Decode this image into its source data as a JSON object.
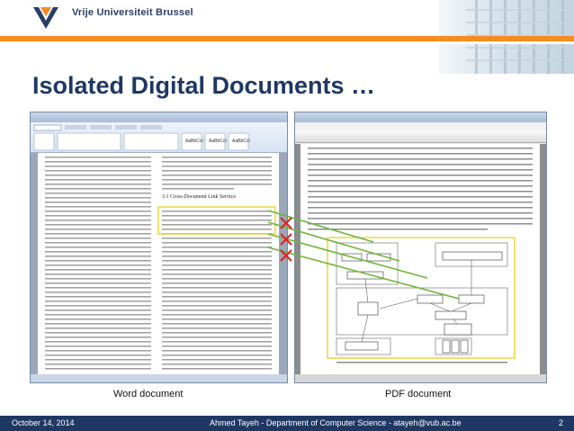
{
  "header": {
    "university_name": "Vrije Universiteit Brussel"
  },
  "slide": {
    "title": "Isolated Digital Documents …"
  },
  "screenshots": {
    "word_caption": "Word document",
    "pdf_caption": "PDF document",
    "word_section_heading": "3.1   Cross-Document Link Service"
  },
  "footer": {
    "date": "October 14, 2014",
    "author": "Ahmed Tayeh - Department of Computer Science - atayeh@vub.ac.be",
    "page_number": "2"
  },
  "colors": {
    "navy": "#1f3863",
    "orange": "#f68b1f",
    "highlight": "#e7d83a",
    "cross_red": "#e02020",
    "connector_green": "#6fb53a"
  }
}
